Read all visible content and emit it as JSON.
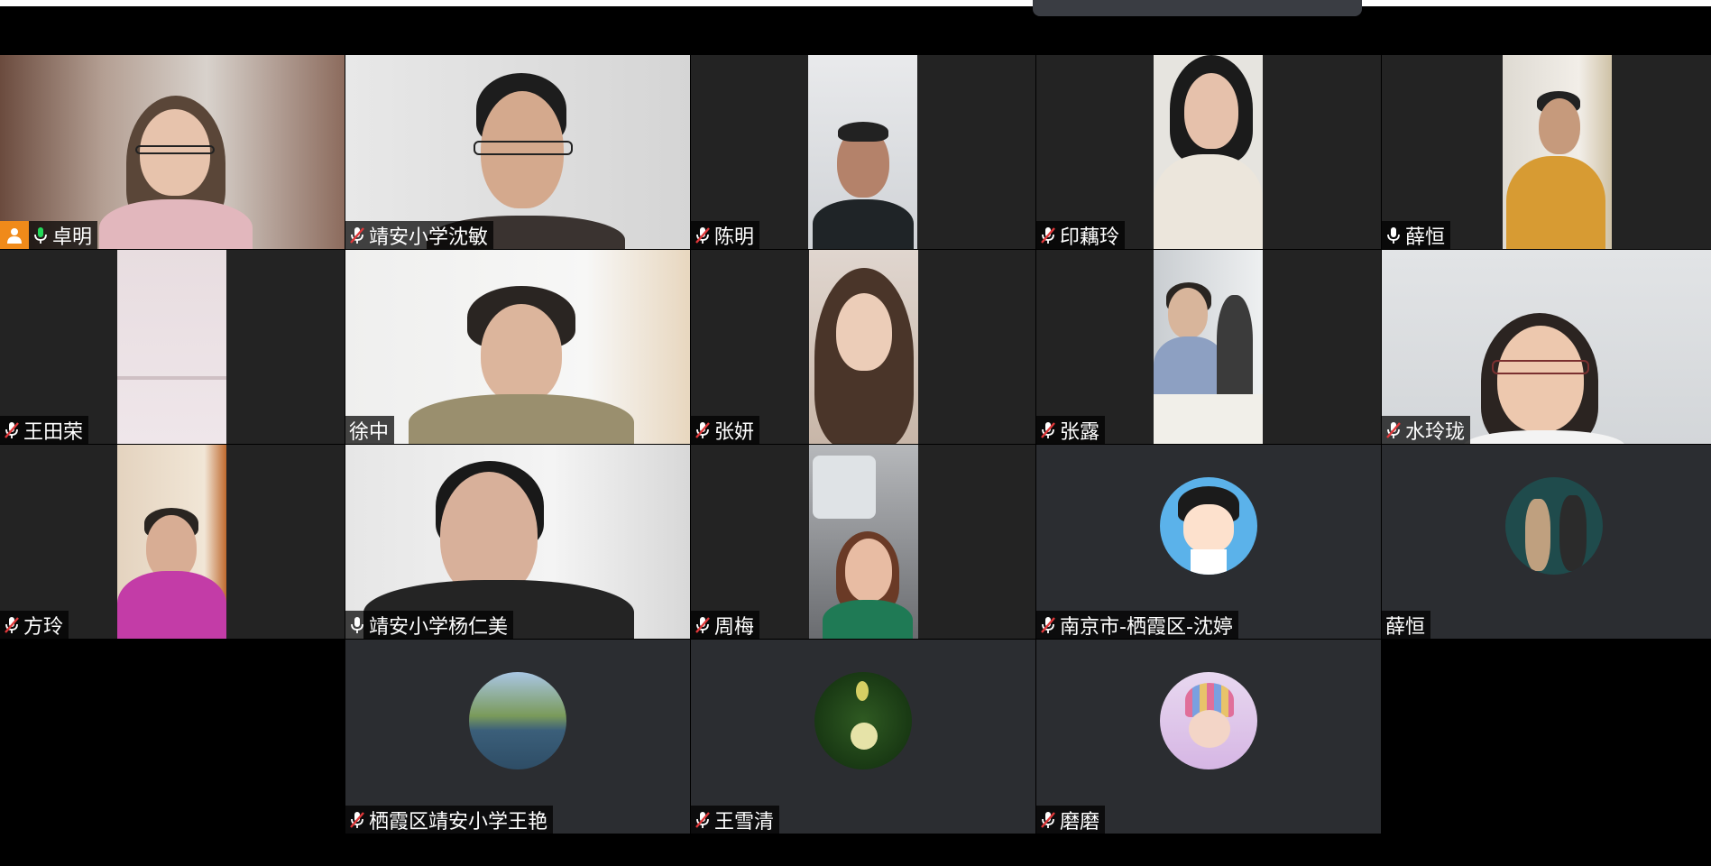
{
  "meeting": {
    "participants": [
      {
        "name": "卓明",
        "audio": "unmuted",
        "host": true,
        "tile": "video-full"
      },
      {
        "name": "靖安小学沈敏",
        "audio": "muted",
        "tile": "video-full"
      },
      {
        "name": "陈明",
        "audio": "muted",
        "tile": "video-narrow"
      },
      {
        "name": "印藕玲",
        "audio": "muted",
        "tile": "video-narrow"
      },
      {
        "name": "薛恒",
        "audio": "unmuted-white",
        "tile": "video-narrow"
      },
      {
        "name": "王田荣",
        "audio": "muted",
        "tile": "video-narrow"
      },
      {
        "name": "徐中",
        "audio": "none",
        "tile": "video-full"
      },
      {
        "name": "张妍",
        "audio": "muted",
        "tile": "video-narrow"
      },
      {
        "name": "张露",
        "audio": "muted",
        "tile": "video-narrow"
      },
      {
        "name": "水玲珑",
        "audio": "muted",
        "tile": "video-full"
      },
      {
        "name": "方玲",
        "audio": "muted",
        "tile": "video-narrow"
      },
      {
        "name": "靖安小学杨仁美",
        "audio": "unmuted-white",
        "tile": "video-full"
      },
      {
        "name": "周梅",
        "audio": "muted",
        "tile": "video-narrow"
      },
      {
        "name": "南京市-栖霞区-沈婷",
        "audio": "muted",
        "tile": "avatar"
      },
      {
        "name": "薛恒",
        "audio": "none",
        "tile": "avatar"
      },
      {
        "name": "栖霞区靖安小学王艳",
        "audio": "muted",
        "tile": "avatar"
      },
      {
        "name": "王雪清",
        "audio": "muted",
        "tile": "avatar"
      },
      {
        "name": "磨磨",
        "audio": "muted",
        "tile": "avatar"
      }
    ]
  },
  "colors": {
    "active_speaker_border": "#23d959",
    "muted_mic": "#e0383a",
    "unmuted_mic": "#23d959",
    "host_badge": "#f08a1a",
    "tile_bg": "#232323",
    "avatar_tile_bg": "#2b2d31"
  },
  "icons": {
    "muted": "mic-muted-icon",
    "unmuted": "mic-icon",
    "host": "host-person-icon"
  }
}
